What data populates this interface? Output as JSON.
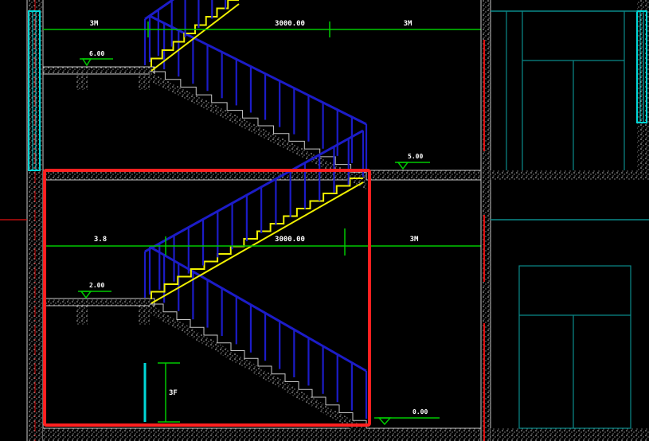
{
  "dimensions": {
    "upper": [
      "3M",
      "3000.00",
      "3M"
    ],
    "lower": [
      "3.8",
      "3000.00",
      "3M"
    ],
    "vertical": "3F"
  },
  "levels": {
    "upper_landing": "6.00",
    "upper_floor": "5.00",
    "lower_landing": "2.00",
    "lower_floor": "0.00"
  },
  "colors": {
    "background": "#000000",
    "wall_hatch": "#c8c8c8",
    "railing": "#1c1cc8",
    "step_line": "#f0f000",
    "dimension": "#00c800",
    "window": "#00d8d8",
    "axis_red": "#e01010",
    "frame_teal": "#0a8a8a",
    "highlight": "#ff2020"
  }
}
